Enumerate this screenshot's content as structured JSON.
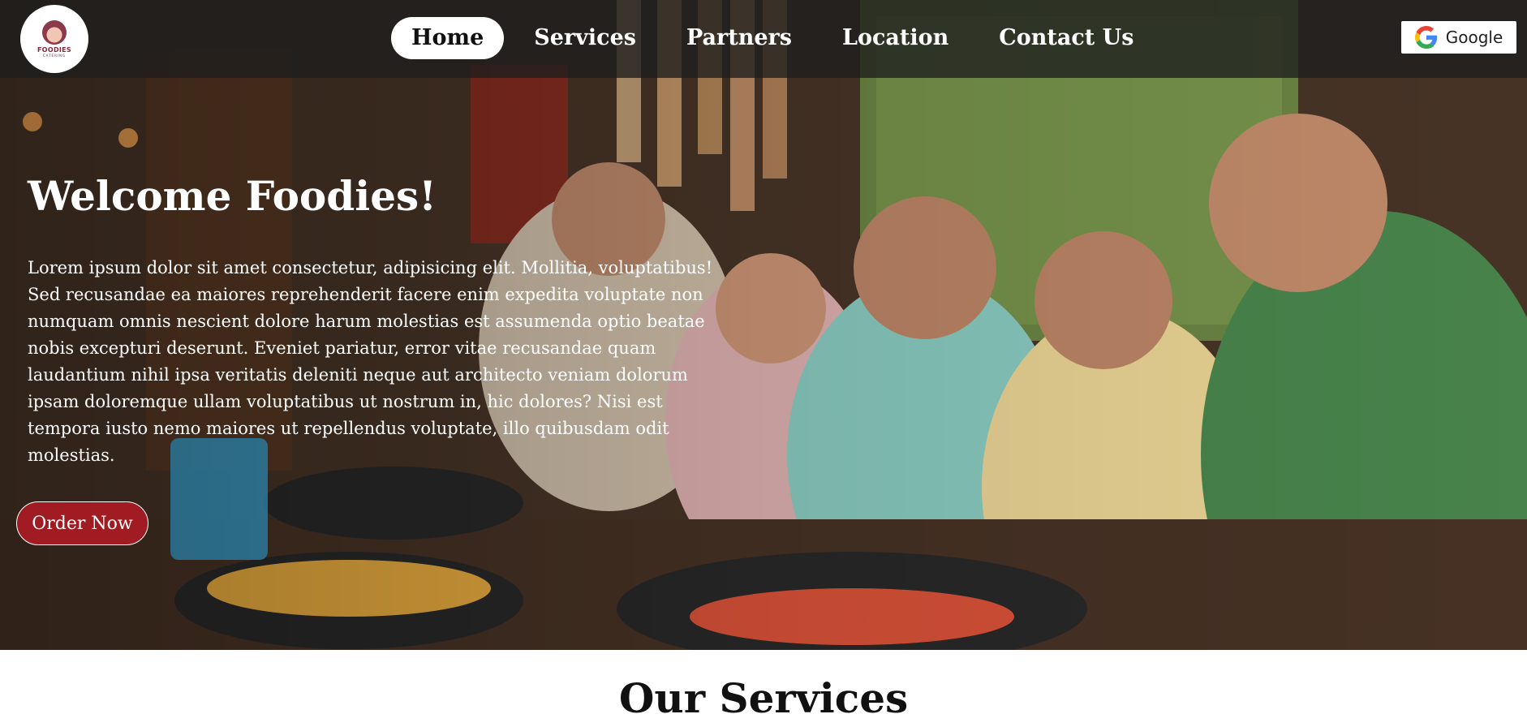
{
  "logo": {
    "name": "FOODIES",
    "sub": "CATERING"
  },
  "nav": {
    "items": [
      {
        "label": "Home",
        "active": true
      },
      {
        "label": "Services",
        "active": false
      },
      {
        "label": "Partners",
        "active": false
      },
      {
        "label": "Location",
        "active": false
      },
      {
        "label": "Contact Us",
        "active": false
      }
    ]
  },
  "google_button": {
    "label": "Google",
    "icon": "google-g-icon"
  },
  "hero": {
    "title": "Welcome Foodies!",
    "text": "Lorem ipsum dolor sit amet consectetur, adipisicing elit. Mollitia, voluptatibus! Sed recusandae ea maiores reprehenderit facere enim expedita voluptate non numquam omnis nescient dolore harum molestias est assumenda optio beatae nobis excepturi deserunt. Eveniet pariatur, error vitae recusandae quam laudantium nihil ipsa veritatis deleniti neque aut architecto veniam dolorum ipsam doloremque ullam voluptatibus ut nostrum in, hic dolores? Nisi est tempora iusto nemo maiores ut repellendus voluptate, illo quibusdam odit molestias.",
    "cta": "Order Now"
  },
  "services": {
    "title": "Our Services"
  },
  "colors": {
    "accent": "#a11c22",
    "nav_bg": "#1e1e1e",
    "text_light": "#ffffff"
  }
}
